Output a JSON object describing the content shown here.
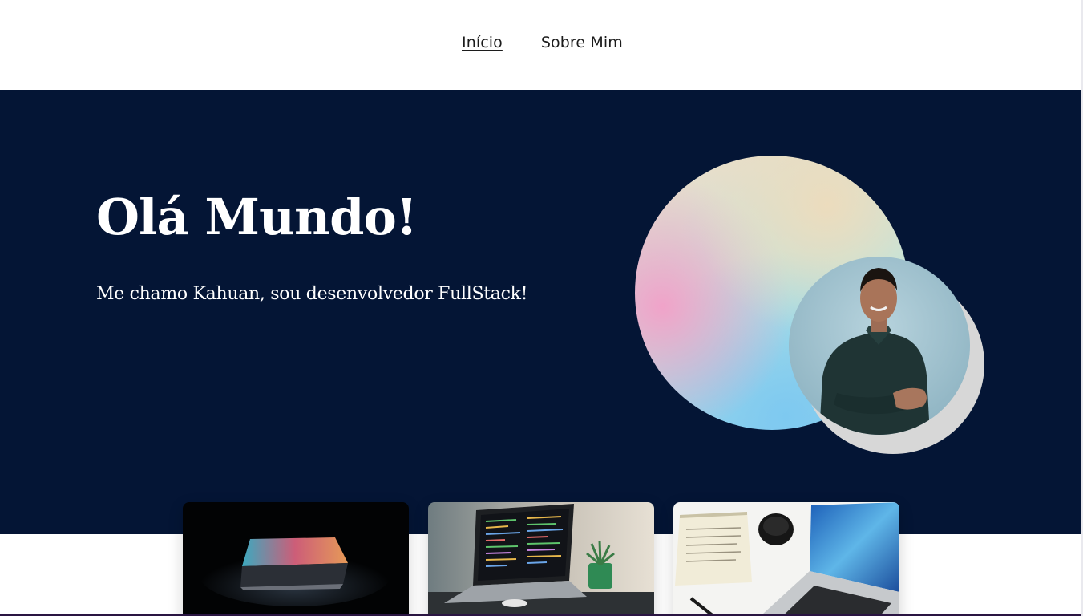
{
  "nav": {
    "links": [
      {
        "label": "Início",
        "active": true
      },
      {
        "label": "Sobre Mim",
        "active": false
      }
    ]
  },
  "hero": {
    "title": "Olá Mundo!",
    "subtitle": "Me chamo Kahuan, sou desenvolvedor FullStack!",
    "background_color": "#041535"
  },
  "cards": [
    {
      "name": "laptop-dark-glow"
    },
    {
      "name": "laptop-code-editor"
    },
    {
      "name": "laptop-desk-notebook"
    }
  ]
}
